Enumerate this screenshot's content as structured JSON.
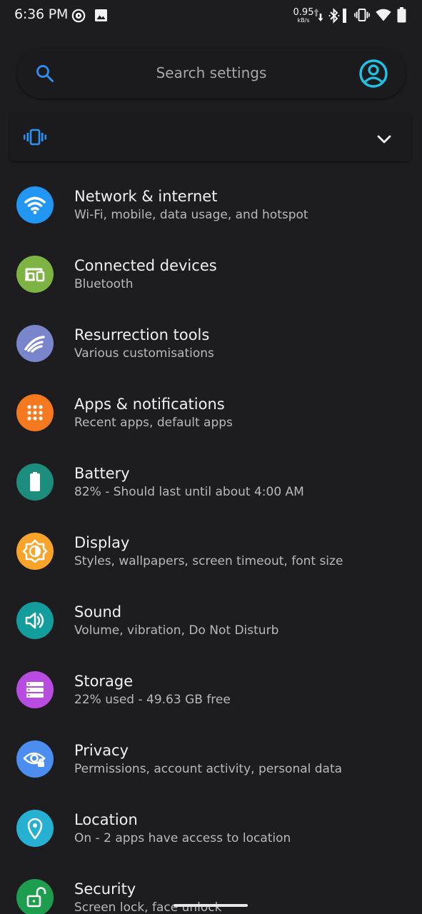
{
  "status_bar": {
    "time": "6:36 PM",
    "net_speed_value": "0.95",
    "net_speed_unit": "kB/s",
    "icons": [
      "media-playing-icon",
      "image-icon",
      "data-arrows-icon",
      "bluetooth-icon",
      "vibrate-icon",
      "wifi-icon",
      "battery-icon"
    ]
  },
  "search": {
    "placeholder": "Search settings",
    "icon": "search-icon",
    "account_icon": "account-circle-icon"
  },
  "conditions": {
    "icon": "vibrate-icon",
    "expand_icon": "chevron-down-icon"
  },
  "items": [
    {
      "title": "Network & internet",
      "summary": "Wi-Fi, mobile, data usage, and hotspot",
      "icon": "wifi-icon",
      "color": "#2196f3"
    },
    {
      "title": "Connected devices",
      "summary": "Bluetooth",
      "icon": "devices-icon",
      "color": "#7cb342"
    },
    {
      "title": "Resurrection tools",
      "summary": "Various customisations",
      "icon": "resurrection-icon",
      "color": "#7986cb"
    },
    {
      "title": "Apps & notifications",
      "summary": "Recent apps, default apps",
      "icon": "apps-grid-icon",
      "color": "#f4791f"
    },
    {
      "title": "Battery",
      "summary": "82% - Should last until about 4:00 AM",
      "icon": "battery-icon",
      "color": "#1c8c7c"
    },
    {
      "title": "Display",
      "summary": "Styles, wallpapers, screen timeout, font size",
      "icon": "brightness-icon",
      "color": "#f8a42a"
    },
    {
      "title": "Sound",
      "summary": "Volume, vibration, Do Not Disturb",
      "icon": "volume-icon",
      "color": "#139d9c"
    },
    {
      "title": "Storage",
      "summary": "22% used - 49.63 GB free",
      "icon": "storage-icon",
      "color": "#b84be0"
    },
    {
      "title": "Privacy",
      "summary": "Permissions, account activity, personal data",
      "icon": "privacy-eye-icon",
      "color": "#4b8ef0"
    },
    {
      "title": "Location",
      "summary": "On - 2 apps have access to location",
      "icon": "location-pin-icon",
      "color": "#26b0d2"
    },
    {
      "title": "Security",
      "summary": "Screen lock, face unlock",
      "icon": "lock-open-icon",
      "color": "#1e9d4e"
    }
  ],
  "accent_color": "#1ec3e6"
}
